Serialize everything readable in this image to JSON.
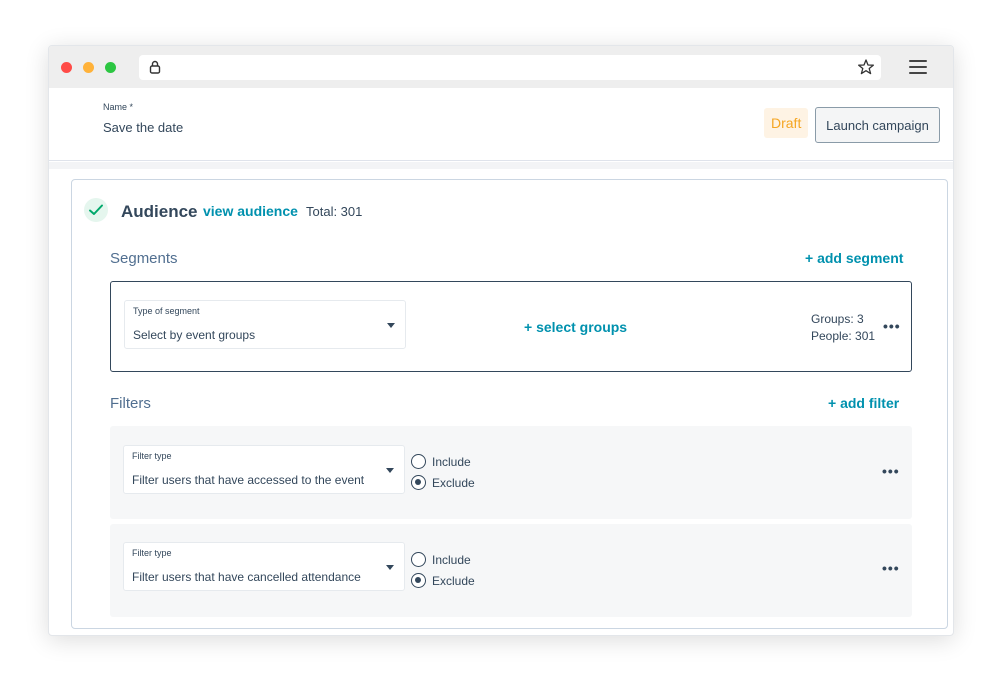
{
  "header": {
    "name_label": "Name *",
    "name_value": "Save the date",
    "status_badge": "Draft",
    "launch_label": "Launch campaign"
  },
  "audience": {
    "title": "Audience",
    "view_link": "view audience",
    "total": "Total: 301"
  },
  "segments": {
    "title": "Segments",
    "add_label": "+ add segment",
    "items": [
      {
        "type_label": "Type of segment",
        "type_value": "Select by event groups",
        "action_label": "+ select groups",
        "groups": "Groups: 3",
        "people": "People: 301",
        "more": "•••"
      }
    ]
  },
  "filters": {
    "title": "Filters",
    "add_label": "+ add filter",
    "items": [
      {
        "type_label": "Filter type",
        "type_value": "Filter users that have accessed to the event",
        "include_label": "Include",
        "exclude_label": "Exclude",
        "selected": "Exclude",
        "more": "•••"
      },
      {
        "type_label": "Filter type",
        "type_value": "Filter users that have cancelled attendance",
        "include_label": "Include",
        "exclude_label": "Exclude",
        "selected": "Exclude",
        "more": "•••"
      }
    ]
  },
  "colors": {
    "accent_link": "#0091ae",
    "draft_text": "#f5a623",
    "text": "#33475b",
    "check": "#00a86b"
  },
  "icons": [
    "lock-icon",
    "star-icon",
    "menu-icon",
    "check-icon",
    "caret-down-icon",
    "more-icon"
  ]
}
